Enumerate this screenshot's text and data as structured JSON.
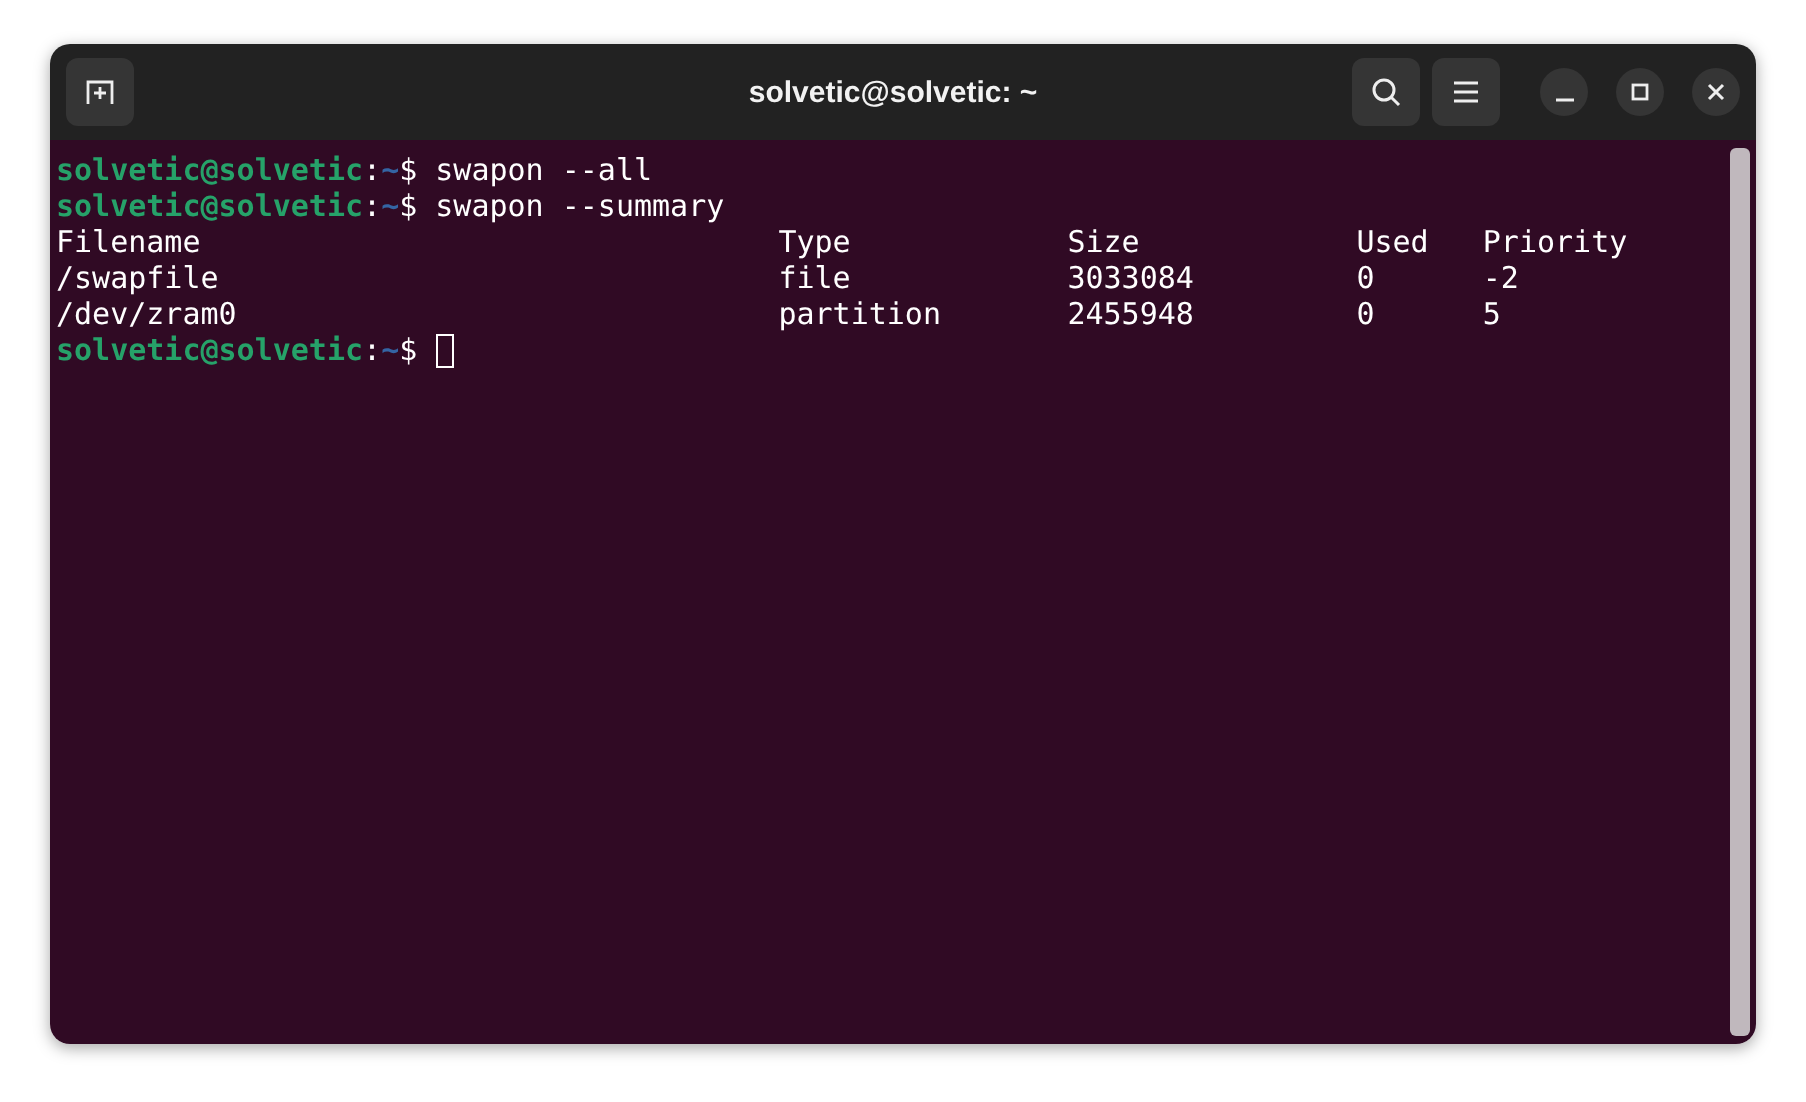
{
  "window": {
    "title": "solvetic@solvetic: ~"
  },
  "terminal": {
    "lines": [
      {
        "kind": "command",
        "user_host": "solvetic@solvetic",
        "separator": ":",
        "path": "~",
        "symbol": "$",
        "command": "swapon --all"
      },
      {
        "kind": "command",
        "user_host": "solvetic@solvetic",
        "separator": ":",
        "path": "~",
        "symbol": "$",
        "command": "swapon --summary"
      },
      {
        "kind": "output",
        "cells": [
          "Filename",
          "Type",
          "Size",
          "Used",
          "Priority"
        ]
      },
      {
        "kind": "output",
        "cells": [
          "/swapfile",
          "file",
          "3033084",
          "0",
          "-2"
        ]
      },
      {
        "kind": "output",
        "cells": [
          "/dev/zram0",
          "partition",
          "2455948",
          "0",
          "5"
        ]
      },
      {
        "kind": "prompt",
        "user_host": "solvetic@solvetic",
        "separator": ":",
        "path": "~",
        "symbol": "$",
        "cursor": true
      }
    ]
  }
}
